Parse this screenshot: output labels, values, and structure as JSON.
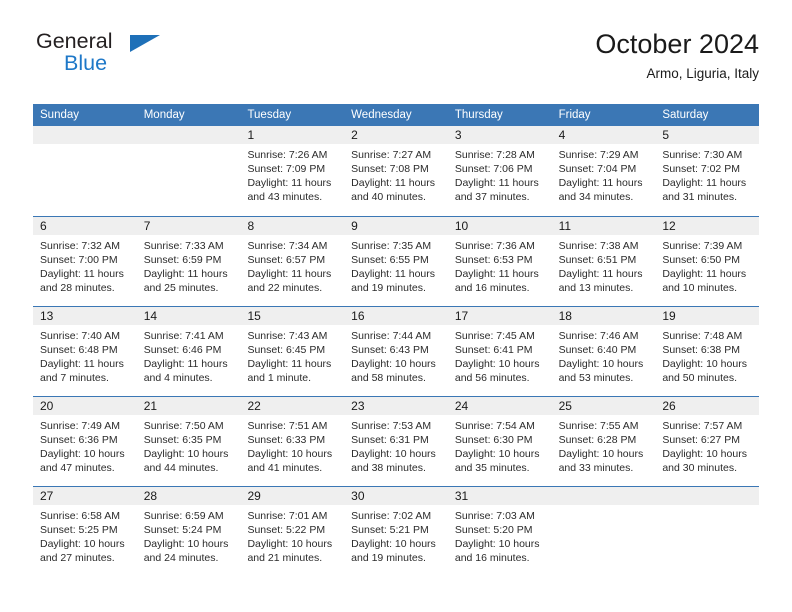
{
  "brand": {
    "name_top": "General",
    "name_bottom": "Blue",
    "triangle_color": "#1e70b8",
    "text_color_top": "#231f20",
    "text_color_bottom": "#1e78c8"
  },
  "header": {
    "title": "October 2024",
    "location": "Armo, Liguria, Italy"
  },
  "theme": {
    "header_blue": "#3b77b5",
    "daynum_band": "#efefef",
    "text": "#1a1a1a"
  },
  "weekdays": [
    "Sunday",
    "Monday",
    "Tuesday",
    "Wednesday",
    "Thursday",
    "Friday",
    "Saturday"
  ],
  "weeks": [
    [
      {
        "day": "",
        "sunrise": "",
        "sunset": "",
        "daylight_line1": "",
        "daylight_line2": ""
      },
      {
        "day": "",
        "sunrise": "",
        "sunset": "",
        "daylight_line1": "",
        "daylight_line2": ""
      },
      {
        "day": "1",
        "sunrise": "Sunrise: 7:26 AM",
        "sunset": "Sunset: 7:09 PM",
        "daylight_line1": "Daylight: 11 hours",
        "daylight_line2": "and 43 minutes."
      },
      {
        "day": "2",
        "sunrise": "Sunrise: 7:27 AM",
        "sunset": "Sunset: 7:08 PM",
        "daylight_line1": "Daylight: 11 hours",
        "daylight_line2": "and 40 minutes."
      },
      {
        "day": "3",
        "sunrise": "Sunrise: 7:28 AM",
        "sunset": "Sunset: 7:06 PM",
        "daylight_line1": "Daylight: 11 hours",
        "daylight_line2": "and 37 minutes."
      },
      {
        "day": "4",
        "sunrise": "Sunrise: 7:29 AM",
        "sunset": "Sunset: 7:04 PM",
        "daylight_line1": "Daylight: 11 hours",
        "daylight_line2": "and 34 minutes."
      },
      {
        "day": "5",
        "sunrise": "Sunrise: 7:30 AM",
        "sunset": "Sunset: 7:02 PM",
        "daylight_line1": "Daylight: 11 hours",
        "daylight_line2": "and 31 minutes."
      }
    ],
    [
      {
        "day": "6",
        "sunrise": "Sunrise: 7:32 AM",
        "sunset": "Sunset: 7:00 PM",
        "daylight_line1": "Daylight: 11 hours",
        "daylight_line2": "and 28 minutes."
      },
      {
        "day": "7",
        "sunrise": "Sunrise: 7:33 AM",
        "sunset": "Sunset: 6:59 PM",
        "daylight_line1": "Daylight: 11 hours",
        "daylight_line2": "and 25 minutes."
      },
      {
        "day": "8",
        "sunrise": "Sunrise: 7:34 AM",
        "sunset": "Sunset: 6:57 PM",
        "daylight_line1": "Daylight: 11 hours",
        "daylight_line2": "and 22 minutes."
      },
      {
        "day": "9",
        "sunrise": "Sunrise: 7:35 AM",
        "sunset": "Sunset: 6:55 PM",
        "daylight_line1": "Daylight: 11 hours",
        "daylight_line2": "and 19 minutes."
      },
      {
        "day": "10",
        "sunrise": "Sunrise: 7:36 AM",
        "sunset": "Sunset: 6:53 PM",
        "daylight_line1": "Daylight: 11 hours",
        "daylight_line2": "and 16 minutes."
      },
      {
        "day": "11",
        "sunrise": "Sunrise: 7:38 AM",
        "sunset": "Sunset: 6:51 PM",
        "daylight_line1": "Daylight: 11 hours",
        "daylight_line2": "and 13 minutes."
      },
      {
        "day": "12",
        "sunrise": "Sunrise: 7:39 AM",
        "sunset": "Sunset: 6:50 PM",
        "daylight_line1": "Daylight: 11 hours",
        "daylight_line2": "and 10 minutes."
      }
    ],
    [
      {
        "day": "13",
        "sunrise": "Sunrise: 7:40 AM",
        "sunset": "Sunset: 6:48 PM",
        "daylight_line1": "Daylight: 11 hours",
        "daylight_line2": "and 7 minutes."
      },
      {
        "day": "14",
        "sunrise": "Sunrise: 7:41 AM",
        "sunset": "Sunset: 6:46 PM",
        "daylight_line1": "Daylight: 11 hours",
        "daylight_line2": "and 4 minutes."
      },
      {
        "day": "15",
        "sunrise": "Sunrise: 7:43 AM",
        "sunset": "Sunset: 6:45 PM",
        "daylight_line1": "Daylight: 11 hours",
        "daylight_line2": "and 1 minute."
      },
      {
        "day": "16",
        "sunrise": "Sunrise: 7:44 AM",
        "sunset": "Sunset: 6:43 PM",
        "daylight_line1": "Daylight: 10 hours",
        "daylight_line2": "and 58 minutes."
      },
      {
        "day": "17",
        "sunrise": "Sunrise: 7:45 AM",
        "sunset": "Sunset: 6:41 PM",
        "daylight_line1": "Daylight: 10 hours",
        "daylight_line2": "and 56 minutes."
      },
      {
        "day": "18",
        "sunrise": "Sunrise: 7:46 AM",
        "sunset": "Sunset: 6:40 PM",
        "daylight_line1": "Daylight: 10 hours",
        "daylight_line2": "and 53 minutes."
      },
      {
        "day": "19",
        "sunrise": "Sunrise: 7:48 AM",
        "sunset": "Sunset: 6:38 PM",
        "daylight_line1": "Daylight: 10 hours",
        "daylight_line2": "and 50 minutes."
      }
    ],
    [
      {
        "day": "20",
        "sunrise": "Sunrise: 7:49 AM",
        "sunset": "Sunset: 6:36 PM",
        "daylight_line1": "Daylight: 10 hours",
        "daylight_line2": "and 47 minutes."
      },
      {
        "day": "21",
        "sunrise": "Sunrise: 7:50 AM",
        "sunset": "Sunset: 6:35 PM",
        "daylight_line1": "Daylight: 10 hours",
        "daylight_line2": "and 44 minutes."
      },
      {
        "day": "22",
        "sunrise": "Sunrise: 7:51 AM",
        "sunset": "Sunset: 6:33 PM",
        "daylight_line1": "Daylight: 10 hours",
        "daylight_line2": "and 41 minutes."
      },
      {
        "day": "23",
        "sunrise": "Sunrise: 7:53 AM",
        "sunset": "Sunset: 6:31 PM",
        "daylight_line1": "Daylight: 10 hours",
        "daylight_line2": "and 38 minutes."
      },
      {
        "day": "24",
        "sunrise": "Sunrise: 7:54 AM",
        "sunset": "Sunset: 6:30 PM",
        "daylight_line1": "Daylight: 10 hours",
        "daylight_line2": "and 35 minutes."
      },
      {
        "day": "25",
        "sunrise": "Sunrise: 7:55 AM",
        "sunset": "Sunset: 6:28 PM",
        "daylight_line1": "Daylight: 10 hours",
        "daylight_line2": "and 33 minutes."
      },
      {
        "day": "26",
        "sunrise": "Sunrise: 7:57 AM",
        "sunset": "Sunset: 6:27 PM",
        "daylight_line1": "Daylight: 10 hours",
        "daylight_line2": "and 30 minutes."
      }
    ],
    [
      {
        "day": "27",
        "sunrise": "Sunrise: 6:58 AM",
        "sunset": "Sunset: 5:25 PM",
        "daylight_line1": "Daylight: 10 hours",
        "daylight_line2": "and 27 minutes."
      },
      {
        "day": "28",
        "sunrise": "Sunrise: 6:59 AM",
        "sunset": "Sunset: 5:24 PM",
        "daylight_line1": "Daylight: 10 hours",
        "daylight_line2": "and 24 minutes."
      },
      {
        "day": "29",
        "sunrise": "Sunrise: 7:01 AM",
        "sunset": "Sunset: 5:22 PM",
        "daylight_line1": "Daylight: 10 hours",
        "daylight_line2": "and 21 minutes."
      },
      {
        "day": "30",
        "sunrise": "Sunrise: 7:02 AM",
        "sunset": "Sunset: 5:21 PM",
        "daylight_line1": "Daylight: 10 hours",
        "daylight_line2": "and 19 minutes."
      },
      {
        "day": "31",
        "sunrise": "Sunrise: 7:03 AM",
        "sunset": "Sunset: 5:20 PM",
        "daylight_line1": "Daylight: 10 hours",
        "daylight_line2": "and 16 minutes."
      },
      {
        "day": "",
        "sunrise": "",
        "sunset": "",
        "daylight_line1": "",
        "daylight_line2": ""
      },
      {
        "day": "",
        "sunrise": "",
        "sunset": "",
        "daylight_line1": "",
        "daylight_line2": ""
      }
    ]
  ]
}
